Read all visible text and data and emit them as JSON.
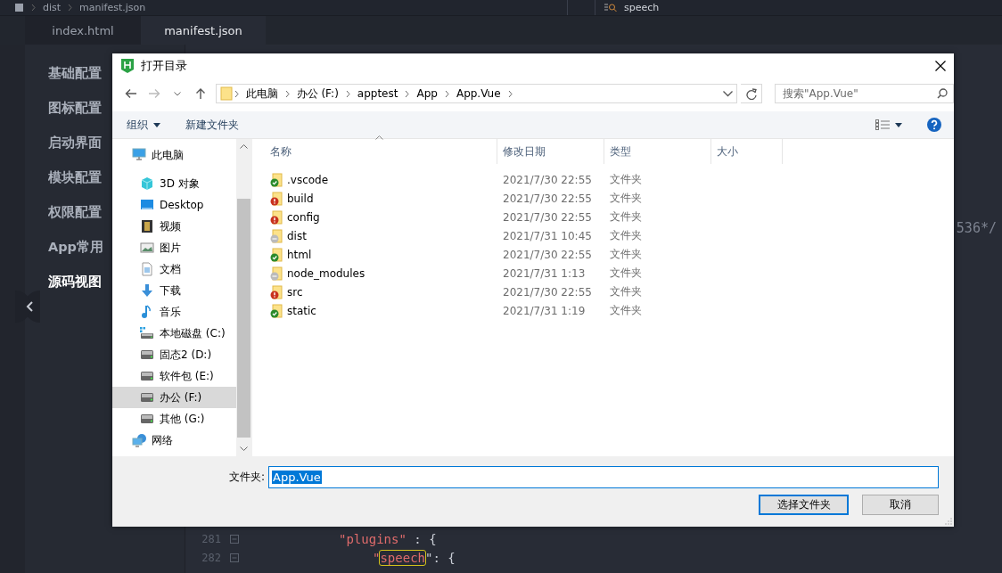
{
  "top_bar": {
    "breadcrumb": [
      "dist",
      "manifest.json"
    ],
    "search": {
      "value": "speech"
    }
  },
  "tabs": [
    {
      "label": "index.html",
      "selected": false
    },
    {
      "label": "manifest.json",
      "selected": true
    }
  ],
  "sidebar": {
    "items": [
      {
        "label": "基础配置",
        "selected": false
      },
      {
        "label": "图标配置",
        "selected": false
      },
      {
        "label": "启动界面",
        "selected": false
      },
      {
        "label": "模块配置",
        "selected": false
      },
      {
        "label": "权限配置",
        "selected": false
      },
      {
        "label": "App常用",
        "selected": false
      },
      {
        "label": "源码视图",
        "selected": true
      }
    ]
  },
  "editor": {
    "fragment": "536*/",
    "lines": [
      {
        "number": "281",
        "foldable": true,
        "tokens": [
          {
            "text": "\"plugins\"",
            "kind": "key"
          },
          {
            "text": " : {",
            "kind": "punct"
          }
        ],
        "children": [
          {
            "number": "282",
            "foldable": true,
            "tokens": [
              {
                "text": "\"",
                "kind": "key"
              },
              {
                "text": "speech",
                "kind": "key",
                "highlighted": true
              },
              {
                "text": "\": {",
                "kind": "punct"
              }
            ]
          }
        ]
      }
    ]
  },
  "dialog": {
    "title": "打开目录",
    "address": [
      "此电脑",
      "办公 (F:)",
      "apptest",
      "App",
      "App.Vue"
    ],
    "search": {
      "placeholder": "搜索\"App.Vue\""
    },
    "toolbar": {
      "organize": "组织",
      "new_folder": "新建文件夹"
    },
    "nav_tree": [
      {
        "label": "此电脑",
        "kind": "computer",
        "selected": false,
        "children": [
          {
            "label": "3D 对象",
            "kind": "cube",
            "selected": false
          },
          {
            "label": "Desktop",
            "kind": "desktop",
            "selected": false
          },
          {
            "label": "视频",
            "kind": "video",
            "selected": false
          },
          {
            "label": "图片",
            "kind": "pictures",
            "selected": false
          },
          {
            "label": "文档",
            "kind": "documents",
            "selected": false
          },
          {
            "label": "下载",
            "kind": "downloads",
            "selected": false
          },
          {
            "label": "音乐",
            "kind": "music",
            "selected": false
          },
          {
            "label": "本地磁盘 (C:)",
            "kind": "system_drive",
            "selected": false
          },
          {
            "label": "固态2 (D:)",
            "kind": "drive",
            "selected": false
          },
          {
            "label": "软件包 (E:)",
            "kind": "drive",
            "selected": false
          },
          {
            "label": "办公 (F:)",
            "kind": "drive",
            "selected": true
          },
          {
            "label": "其他 (G:)",
            "kind": "drive",
            "selected": false
          }
        ]
      },
      {
        "label": "网络",
        "kind": "network",
        "selected": false
      }
    ],
    "columns": [
      "名称",
      "修改日期",
      "类型",
      "大小"
    ],
    "files": [
      {
        "name": ".vscode",
        "modified": "2021/7/30 22:55",
        "type": "文件夹",
        "kind": "ok"
      },
      {
        "name": "build",
        "modified": "2021/7/30 22:55",
        "type": "文件夹",
        "kind": "error"
      },
      {
        "name": "config",
        "modified": "2021/7/30 22:55",
        "type": "文件夹",
        "kind": "error"
      },
      {
        "name": "dist",
        "modified": "2021/7/31 10:45",
        "type": "文件夹",
        "kind": "ignored"
      },
      {
        "name": "html",
        "modified": "2021/7/30 22:55",
        "type": "文件夹",
        "kind": "ok"
      },
      {
        "name": "node_modules",
        "modified": "2021/7/31 1:13",
        "type": "文件夹",
        "kind": "ignored"
      },
      {
        "name": "src",
        "modified": "2021/7/30 22:55",
        "type": "文件夹",
        "kind": "error"
      },
      {
        "name": "static",
        "modified": "2021/7/31 1:19",
        "type": "文件夹",
        "kind": "ok"
      }
    ],
    "folder_label": "文件夹:",
    "folder_value": "App.Vue",
    "buttons": [
      {
        "label": "选择文件夹",
        "default": true
      },
      {
        "label": "取消",
        "default": false
      }
    ]
  }
}
